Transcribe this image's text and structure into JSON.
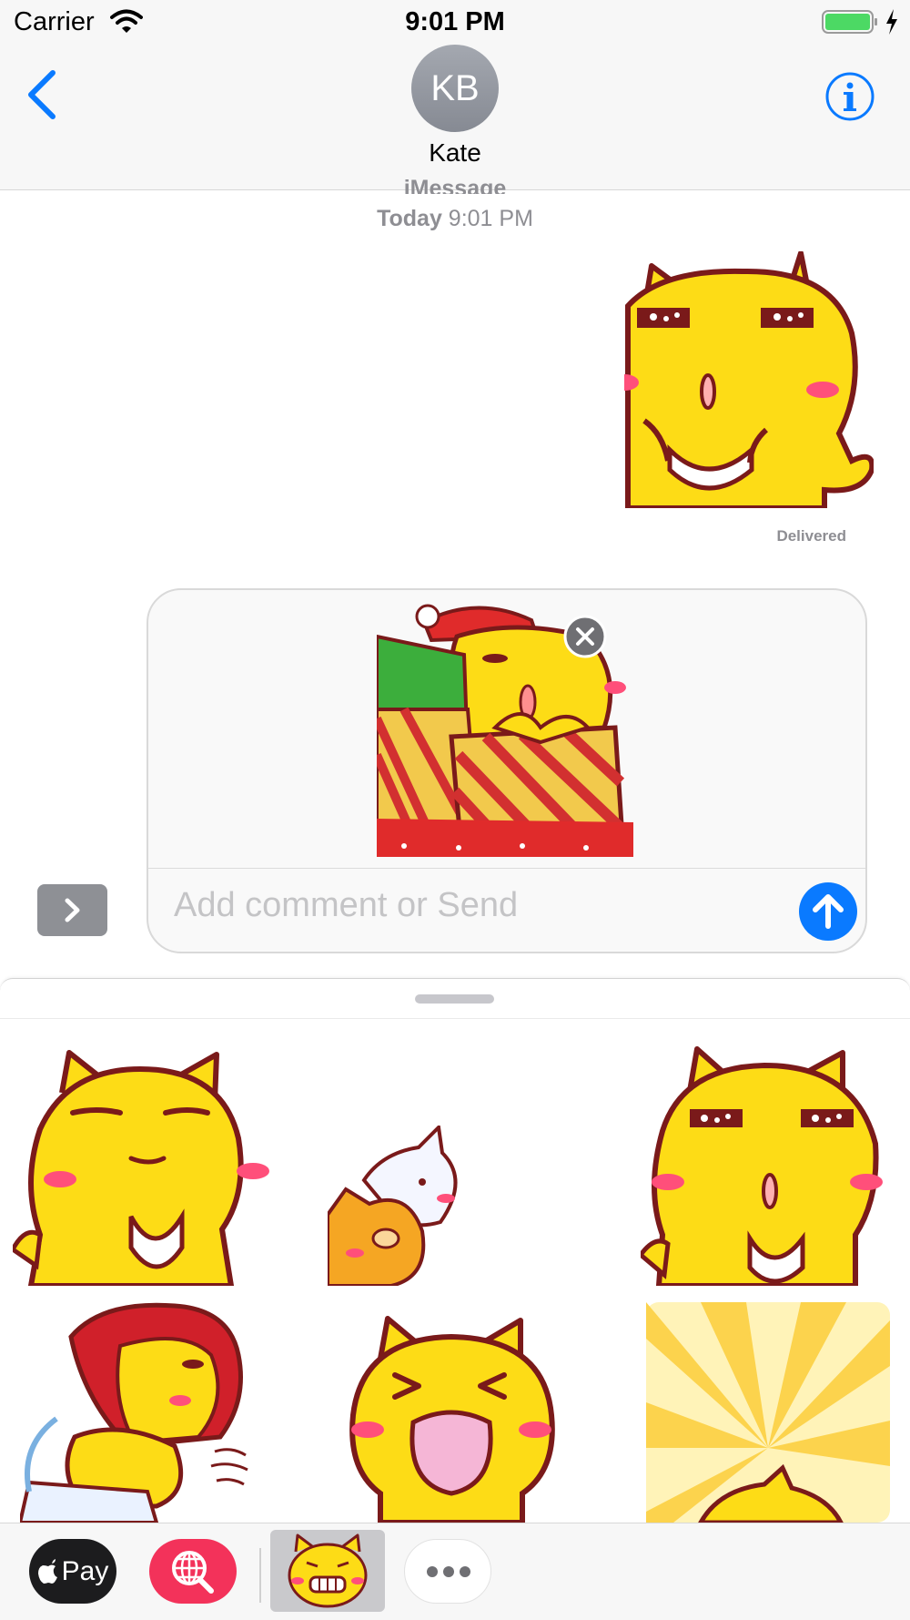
{
  "status_bar": {
    "carrier": "Carrier",
    "time": "9:01 PM"
  },
  "header": {
    "avatar_initials": "KB",
    "contact_name": "Kate"
  },
  "conversation": {
    "service_label": "iMessage",
    "timestamp_day": "Today",
    "timestamp_time": "9:01 PM",
    "delivery_status": "Delivered"
  },
  "compose": {
    "placeholder": "Add comment or Send"
  },
  "app_strip": {
    "apple_pay_label": "Pay"
  },
  "colors": {
    "accent": "#0a7aff",
    "cat_yellow": "#fddc16",
    "outline": "#7a1a1a",
    "blush": "#ff4f7a",
    "globe_app": "#f3325a"
  }
}
